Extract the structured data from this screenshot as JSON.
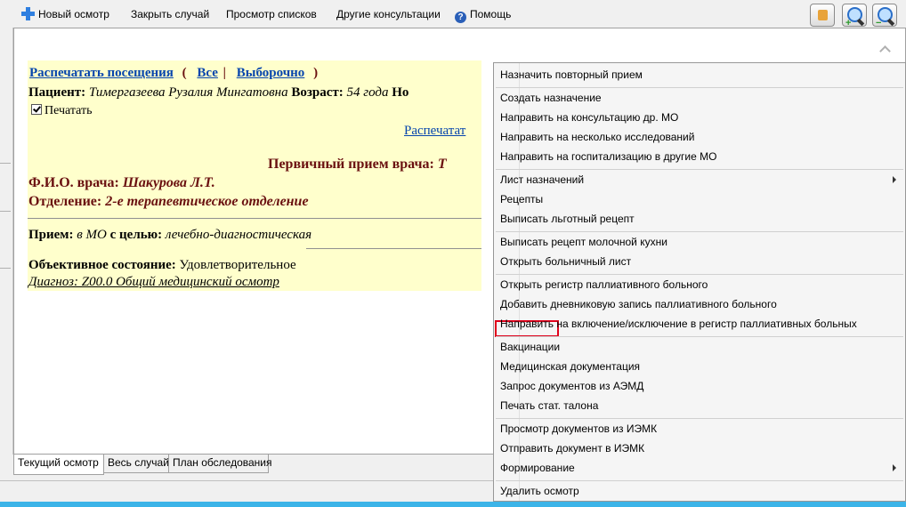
{
  "toolbar": {
    "items": [
      "Новый осмотр",
      "Закрыть случай",
      "Просмотр списков",
      "Другие консультации",
      "Помощь"
    ],
    "buttons": [
      "thumb-up-icon",
      "zoom-in-icon",
      "zoom-out-icon"
    ]
  },
  "document": {
    "print_visits": "Распечатать посещения",
    "open_paren": "(",
    "all": "Все",
    "bar": "|",
    "selective": "Выборочно",
    "close_paren": ")",
    "patient_label": "Пациент:",
    "patient_name": "Тимергазеева Рузалия Мингатовна",
    "age_label": "Возраст:",
    "age_value": "54 года",
    "cut_label": "Но",
    "print_label": "Печатать",
    "print_link": "Распечатат",
    "primary_visit": "Первичный прием врача:",
    "primary_cut": "Т",
    "doctor_label": "Ф.И.О. врача:",
    "doctor_value": "Шакурова Л.Т.",
    "dept_label": "Отделение:",
    "dept_value": "2-е терапевтическое отделение",
    "reception_label": "Прием:",
    "reception_place": "в МО",
    "purpose_label": "с целью:",
    "purpose_value": "лечебно-диагностическая",
    "objective_label": "Объективное состояние:",
    "objective_value": "Удовлетворительное",
    "diagnosis": "Диагноз: Z00.0 Общий медицинский осмотр"
  },
  "tabs": [
    "Текущий осмотр",
    "Весь случай",
    "План обследования"
  ],
  "menu": {
    "items": [
      "Назначить повторный прием",
      "Создать назначение",
      "Направить на консультацию др. МО",
      "Направить на несколько исследований",
      "Направить на госпитализацию в другие МО",
      "Лист назначений",
      "Рецепты",
      "Выписать льготный рецепт",
      "Выписать рецепт молочной кухни",
      "Открыть больничный лист",
      "Открыть регистр паллиативного больного",
      "Добавить дневниковую запись паллиативного больного",
      "Направить на включение/исключение в регистр паллиативных больных",
      "Вакцинации",
      "Медицинская документация",
      "Запрос документов из АЭМД",
      "Печать стат. талона",
      "Просмотр документов из ИЭМК",
      "Отправить документ в ИЭМК",
      "Формирование",
      "Удалить осмотр"
    ],
    "highlight_color": "#e0001b"
  }
}
